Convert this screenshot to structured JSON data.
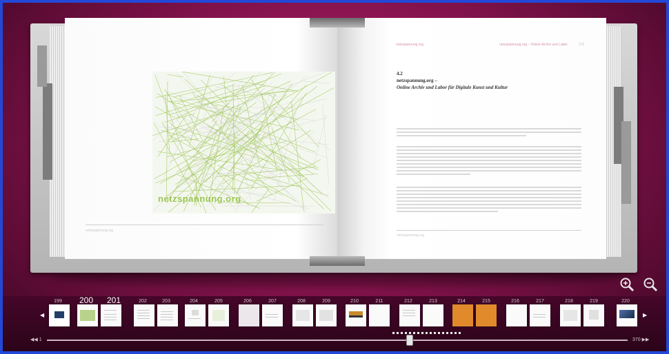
{
  "book": {
    "left_page": {
      "figure_caption": "netzspannung.org",
      "footer": "netzspannung.org"
    },
    "right_page": {
      "header_left": "netzspannung.org",
      "header_mid": "netzspannung.org – Online Archiv und Labor",
      "header_num": "215",
      "section_number": "4.2",
      "section_title": "netzspannung.org –",
      "section_subtitle": "Online Archiv und Labor für Digitale Kunst und Kultur",
      "footer": "netzspannung.org"
    }
  },
  "controls": {
    "zoom_in_icon": "zoom-in-icon",
    "zoom_out_icon": "zoom-out-icon"
  },
  "thumbnails": {
    "page_numbers": [
      "199",
      "200",
      "201",
      "202",
      "203",
      "204",
      "205",
      "206",
      "207",
      "208",
      "209",
      "210",
      "211",
      "212",
      "213",
      "214",
      "215",
      "216",
      "217",
      "218",
      "219",
      "220"
    ],
    "current_pages": [
      "200",
      "201"
    ],
    "highlighted_pages": [
      "214",
      "215"
    ],
    "highlight_color": "#e08a2c"
  },
  "slider": {
    "start_label": "1",
    "end_label": "370",
    "position_fraction": 0.58
  },
  "colors": {
    "background": "#8a1450",
    "frame_border": "#2348d8",
    "figure_lines": "#8fbf3a"
  }
}
